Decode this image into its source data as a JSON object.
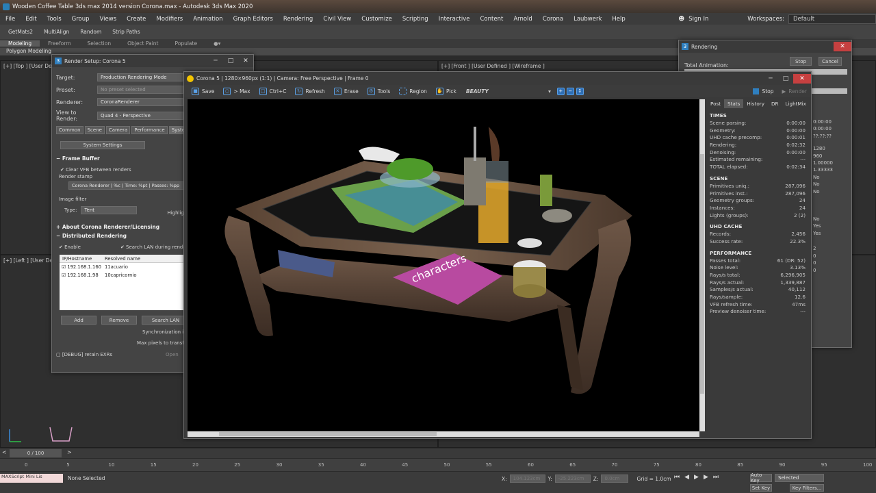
{
  "window": {
    "title": "Wooden Coffee Table 3ds max 2014 version Corona.max - Autodesk 3ds Max 2020"
  },
  "menu": [
    "File",
    "Edit",
    "Tools",
    "Group",
    "Views",
    "Create",
    "Modifiers",
    "Animation",
    "Graph Editors",
    "Rendering",
    "Civil View",
    "Customize",
    "Scripting",
    "Interactive",
    "Content",
    "Arnold",
    "Corona",
    "Laubwerk",
    "Help"
  ],
  "account": {
    "sign_in": "Sign In",
    "workspaces_label": "Workspaces:",
    "workspace": "Default"
  },
  "toolbar": [
    "GetMats2",
    "MultiAlign",
    "Random",
    "Strip Paths"
  ],
  "ribbon": [
    "Modeling",
    "Freeform",
    "Selection",
    "Object Paint",
    "Populate"
  ],
  "polybar": "Polygon Modeling",
  "viewports": {
    "top": "[+] [Top ] [User Defi",
    "front": "[+] [Front ] [User Defined ] [Wireframe ]",
    "left": "[+] [Left ] [User Defi"
  },
  "render_setup": {
    "title": "Render Setup: Corona 5",
    "target_label": "Target:",
    "target": "Production Rendering Mode",
    "preset_label": "Preset:",
    "preset": "No preset selected",
    "renderer_label": "Renderer:",
    "renderer": "CoronaRenderer",
    "view_label": "View to Render:",
    "view": "Quad 4 - Perspective",
    "tabs": [
      "Common",
      "Scene",
      "Camera",
      "Performance",
      "System",
      "Re"
    ],
    "system_settings": "System Settings",
    "frame_buffer": "Frame Buffer",
    "clear_vfb": "Clear VFB between renders",
    "render_stamp_label": "Render stamp",
    "render_stamp": "Corona Renderer | %c | Time: %pt | Passes: %pp",
    "image_filter": "Image filter",
    "type_label": "Type:",
    "type": "Tent",
    "highlight": "Highligh",
    "about": "About Corona Renderer/Licensing",
    "distributed": "Distributed Rendering",
    "enable": "Enable",
    "search_lan_during": "Search LAN during rende",
    "dr_headers": [
      "IP/Hostname",
      "Resolved name"
    ],
    "dr_rows": [
      {
        "ip": "192.168.1.160",
        "name": "11acuario"
      },
      {
        "ip": "192.168.1.98",
        "name": "10capricornio"
      }
    ],
    "add": "Add",
    "remove": "Remove",
    "search_lan": "Search LAN",
    "sync": "Synchronization in",
    "max_pixels": "Max pixels to transfe",
    "debug": "[DEBUG] retain EXRs",
    "open": "Open"
  },
  "rendering_dialog": {
    "title": "Rendering",
    "stop": "Stop",
    "cancel": "Cancel",
    "total_animation": "Total Animation:",
    "side_values": [
      "0:00:00",
      "0:00:00",
      "??:??:??",
      "1280",
      "960",
      "1.00000",
      "1.33333",
      "No",
      "No",
      "No",
      "No",
      "Yes",
      "Yes",
      "2",
      "0",
      "0",
      "0"
    ]
  },
  "vfb": {
    "title": "Corona 5 | 1280×960px (1:1) | Camera: Free Perspective | Frame 0",
    "tools": [
      "Save",
      "> Max",
      "Ctrl+C",
      "Refresh",
      "Erase",
      "Tools",
      "Region",
      "Pick"
    ],
    "channel": "BEAUTY",
    "stop": "Stop",
    "render": "Render",
    "tabs": [
      "Post",
      "Stats",
      "History",
      "DR",
      "LightMix"
    ],
    "sections": [
      {
        "title": "TIMES",
        "rows": [
          [
            "Scene parsing:",
            "0:00:00"
          ],
          [
            "Geometry:",
            "0:00:00"
          ],
          [
            "UHD cache precomp:",
            "0:00:01"
          ],
          [
            "Rendering:",
            "0:02:32"
          ],
          [
            "Denoising:",
            "0:00:00"
          ],
          [
            "Estimated remaining:",
            "---"
          ],
          [
            "TOTAL elapsed:",
            "0:02:34"
          ]
        ]
      },
      {
        "title": "SCENE",
        "rows": [
          [
            "Primitives uniq.:",
            "287,096"
          ],
          [
            "Primitives inst.:",
            "287,096"
          ],
          [
            "Geometry groups:",
            "24"
          ],
          [
            "Instances:",
            "24"
          ],
          [
            "Lights (groups):",
            "2 (2)"
          ]
        ]
      },
      {
        "title": "UHD CACHE",
        "rows": [
          [
            "Records:",
            "2,456"
          ],
          [
            "Success rate:",
            "22.3%"
          ]
        ]
      },
      {
        "title": "PERFORMANCE",
        "rows": [
          [
            "Passes total:",
            "61 (DR: 52)"
          ],
          [
            "Noise level:",
            "3.13%"
          ],
          [
            "Rays/s total:",
            "6,296,905"
          ],
          [
            "Rays/s actual:",
            "1,339,887"
          ],
          [
            "Samples/s actual:",
            "40,112"
          ],
          [
            "Rays/sample:",
            "12.6"
          ],
          [
            "VFB refresh time:",
            "47ms"
          ],
          [
            "Preview denoiser time:",
            "---"
          ]
        ]
      }
    ]
  },
  "timeline": {
    "frame": "0 / 100",
    "ticks": [
      "0",
      "5",
      "10",
      "15",
      "20",
      "25",
      "30",
      "35",
      "40",
      "45",
      "50",
      "55",
      "60",
      "65",
      "70",
      "75",
      "80",
      "85",
      "90",
      "95",
      "100"
    ]
  },
  "status": {
    "none_selected": "None Selected",
    "x_label": "X:",
    "x": "104.123cm",
    "y_label": "Y:",
    "y": "-25.223cm",
    "z_label": "Z:",
    "z": "0.0cm",
    "grid": "Grid = 1.0cm",
    "auto_key": "Auto Key",
    "selected": "Selected",
    "set_key": "Set Key",
    "key_filters": "Key Filters...",
    "script": "MAXScript Mini Lis"
  },
  "colors": {
    "accent": "#2f7fbf",
    "close": "#c64040",
    "bg": "#2b2b2b"
  }
}
